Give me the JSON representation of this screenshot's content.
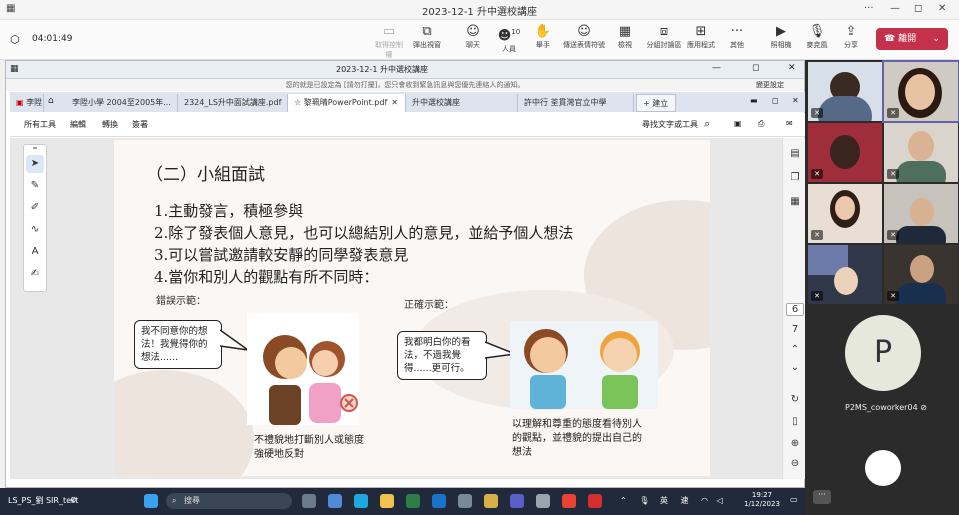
{
  "window": {
    "title": "2023-12-1 升中選校講座"
  },
  "meeting": {
    "timer": "04:01:49"
  },
  "toolbar": {
    "items": [
      {
        "label": "取得控制權",
        "icon": "control-icon"
      },
      {
        "label": "彈出視窗",
        "icon": "popout-icon"
      },
      {
        "label": "聊天",
        "icon": "chat-icon"
      },
      {
        "label": "人員",
        "icon": "people-icon",
        "count": "10"
      },
      {
        "label": "舉手",
        "icon": "raise-hand-icon"
      },
      {
        "label": "傳送表情符號",
        "icon": "emoji-icon"
      },
      {
        "label": "檢視",
        "icon": "view-icon"
      },
      {
        "label": "分組討論區",
        "icon": "breakout-icon"
      },
      {
        "label": "應用程式",
        "icon": "apps-icon"
      },
      {
        "label": "其他",
        "icon": "more-icon"
      },
      {
        "label": "照相機",
        "icon": "camera-icon"
      },
      {
        "label": "麥克風",
        "icon": "mic-icon"
      },
      {
        "label": "分享",
        "icon": "share-icon"
      }
    ],
    "leave_label": "離開"
  },
  "shared": {
    "title": "2023-12-1 升中選校講座",
    "notice": "您的就是已設定為 [請勿打擾]，您只會收到緊急訊息與您優先連絡人的通知。",
    "notice_btn": "變更設定",
    "tabs": [
      "李陞",
      "李陞小學 2004至2005年...",
      "2324_LS升中面試講座.pdf",
      "黎珮晴PowerPoint.pdf",
      "升中選校講座",
      "許中行 荃貫灣官立中學"
    ],
    "new_tab": "+ 建立",
    "menu": [
      "所有工具",
      "編輯",
      "轉換",
      "簽署"
    ],
    "find_label": "尋找文字或工具"
  },
  "slide": {
    "heading": "（二）小組面試",
    "points": [
      "1.主動發言，積極參與",
      "2.除了發表個人意見，也可以總結別人的意見，並給予個人想法",
      "3.可以嘗試邀請較安靜的同學發表意見",
      "4.當你和別人的觀點有所不同時："
    ],
    "wrong_label": "錯誤示範：",
    "right_label": "正確示範：",
    "wrong_bubble": "我不同意你的想法！我覺得你的想法......",
    "right_bubble": "我都明白你的看法，不過我覺得......更可行。",
    "wrong_caption": "不禮貌地打斷別人或態度強硬地反對",
    "right_caption": "以理解和尊重的態度看待別人的觀點，並禮貌的提出自己的想法"
  },
  "pager": {
    "current": "6",
    "next": "7"
  },
  "taskbar": {
    "presenter": "LS_PS_劉 SIR_test",
    "search": "搜尋",
    "ime1": "英",
    "ime2": "速",
    "time": "19:27",
    "date": "1/12/2023"
  },
  "participants": {
    "highlight": "P",
    "name": "P2MS_coworker04"
  },
  "colors": {
    "leave": "#c4314b",
    "taskbar": "#202a3a",
    "panel": "#2b2b2b",
    "accent": "#6264a7"
  }
}
